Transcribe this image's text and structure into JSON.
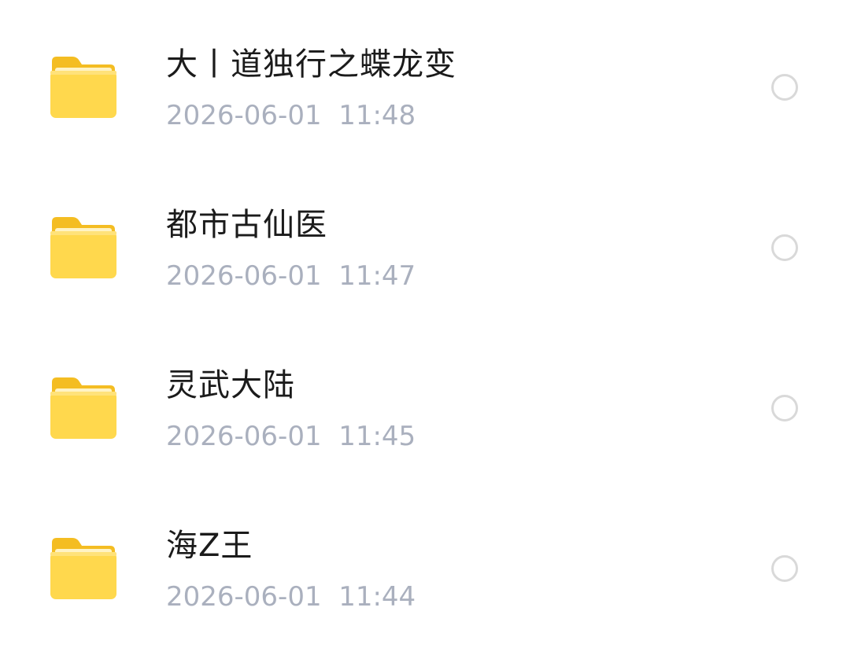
{
  "files": [
    {
      "name": "大丨道独行之蝶龙变",
      "time": "2026-06-01  11:48",
      "icon": "folder-icon"
    },
    {
      "name": "都市古仙医",
      "time": "2026-06-01  11:47",
      "icon": "folder-icon"
    },
    {
      "name": "灵武大陆",
      "time": "2026-06-01  11:45",
      "icon": "folder-icon"
    },
    {
      "name": "海Z王",
      "time": "2026-06-01  11:44",
      "icon": "folder-icon"
    }
  ],
  "colors": {
    "folder_back": "#F7C62B",
    "folder_front": "#FFD84D",
    "name_text": "#1B1B1B",
    "time_text": "#AAB0BE",
    "select_ring": "#D9D9D9"
  }
}
